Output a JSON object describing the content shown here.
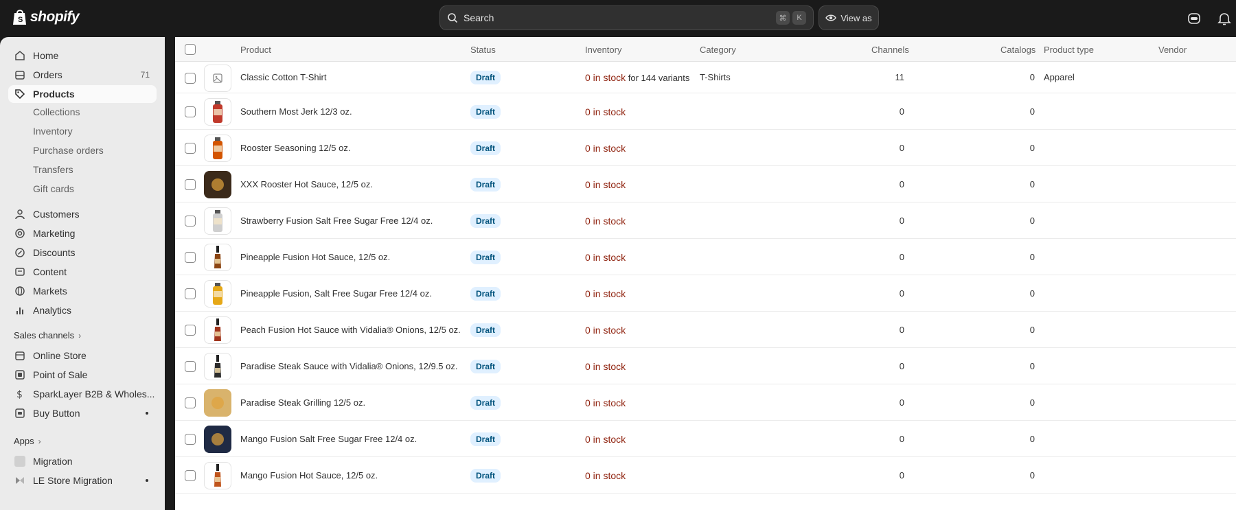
{
  "brand": {
    "name": "shopify"
  },
  "search": {
    "label": "Search",
    "shortcut": [
      "⌘",
      "K"
    ]
  },
  "view_as": {
    "label": "View as"
  },
  "sidebar": {
    "main_items": [
      {
        "label": "Home",
        "icon": "home-icon"
      },
      {
        "label": "Orders",
        "icon": "orders-icon",
        "badge": "71"
      },
      {
        "label": "Products",
        "icon": "tag-icon",
        "active": true
      }
    ],
    "product_sub_items": [
      "Collections",
      "Inventory",
      "Purchase orders",
      "Transfers",
      "Gift cards"
    ],
    "other_items": [
      {
        "label": "Customers",
        "icon": "person-icon"
      },
      {
        "label": "Marketing",
        "icon": "target-icon"
      },
      {
        "label": "Discounts",
        "icon": "discount-icon"
      },
      {
        "label": "Content",
        "icon": "content-icon"
      },
      {
        "label": "Markets",
        "icon": "globe-icon"
      },
      {
        "label": "Analytics",
        "icon": "chart-icon"
      }
    ],
    "sales_channels_label": "Sales channels",
    "sales_channels": [
      {
        "label": "Online Store",
        "icon": "store-icon"
      },
      {
        "label": "Point of Sale",
        "icon": "pos-icon"
      },
      {
        "label": "SparkLayer B2B & Wholes...",
        "icon": "dollar-icon"
      },
      {
        "label": "Buy Button",
        "icon": "buy-button-icon",
        "dot": true
      }
    ],
    "apps_label": "Apps",
    "apps": [
      {
        "label": "Migration",
        "icon": "migration-app-icon"
      },
      {
        "label": "LE Store Migration",
        "icon": "le-migration-app-icon",
        "dot": true
      }
    ]
  },
  "table": {
    "headers": {
      "product": "Product",
      "status": "Status",
      "inventory": "Inventory",
      "category": "Category",
      "channels": "Channels",
      "catalogs": "Catalogs",
      "product_type": "Product type",
      "vendor": "Vendor"
    },
    "rows": [
      {
        "name": "Classic Cotton T-Shirt",
        "status": "Draft",
        "stock": "0 in stock",
        "stock_extra": "for 144 variants",
        "category": "T-Shirts",
        "channels": "11",
        "catalogs": "0",
        "product_type": "Apparel",
        "vendor": "",
        "thumb": "placeholder",
        "color": "#e3e3e3"
      },
      {
        "name": "Southern Most Jerk 12/3 oz.",
        "status": "Draft",
        "stock": "0 in stock",
        "channels": "0",
        "catalogs": "0",
        "thumb": "bottle",
        "color": "#c0392b"
      },
      {
        "name": "Rooster Seasoning 12/5 oz.",
        "status": "Draft",
        "stock": "0 in stock",
        "channels": "0",
        "catalogs": "0",
        "thumb": "bottle",
        "color": "#d35400"
      },
      {
        "name": "XXX Rooster Hot Sauce, 12/5 oz.",
        "status": "Draft",
        "stock": "0 in stock",
        "channels": "0",
        "catalogs": "0",
        "thumb": "photo",
        "color": "#3b2a1a"
      },
      {
        "name": "Strawberry Fusion Salt Free Sugar Free 12/4 oz.",
        "status": "Draft",
        "stock": "0 in stock",
        "channels": "0",
        "catalogs": "0",
        "thumb": "bottle",
        "color": "#cfcfcf"
      },
      {
        "name": "Pineapple Fusion Hot Sauce, 12/5 oz.",
        "status": "Draft",
        "stock": "0 in stock",
        "channels": "0",
        "catalogs": "0",
        "thumb": "slim-bottle",
        "color": "#8b4513"
      },
      {
        "name": "Pineapple Fusion, Salt Free Sugar Free 12/4 oz.",
        "status": "Draft",
        "stock": "0 in stock",
        "channels": "0",
        "catalogs": "0",
        "thumb": "bottle",
        "color": "#e6a817"
      },
      {
        "name": "Peach Fusion Hot Sauce with Vidalia® Onions, 12/5 oz.",
        "status": "Draft",
        "stock": "0 in stock",
        "channels": "0",
        "catalogs": "0",
        "thumb": "slim-bottle",
        "color": "#a0341c"
      },
      {
        "name": "Paradise Steak Sauce with Vidalia® Onions, 12/9.5 oz.",
        "status": "Draft",
        "stock": "0 in stock",
        "channels": "0",
        "catalogs": "0",
        "thumb": "slim-bottle",
        "color": "#2b2b2b"
      },
      {
        "name": "Paradise Steak Grilling 12/5 oz.",
        "status": "Draft",
        "stock": "0 in stock",
        "channels": "0",
        "catalogs": "0",
        "thumb": "photo",
        "color": "#d9b36c"
      },
      {
        "name": "Mango Fusion Salt Free Sugar Free 12/4 oz.",
        "status": "Draft",
        "stock": "0 in stock",
        "channels": "0",
        "catalogs": "0",
        "thumb": "photo",
        "color": "#1f2a44"
      },
      {
        "name": "Mango Fusion Hot Sauce, 12/5 oz.",
        "status": "Draft",
        "stock": "0 in stock",
        "channels": "0",
        "catalogs": "0",
        "thumb": "slim-bottle",
        "color": "#c0541c"
      }
    ]
  }
}
